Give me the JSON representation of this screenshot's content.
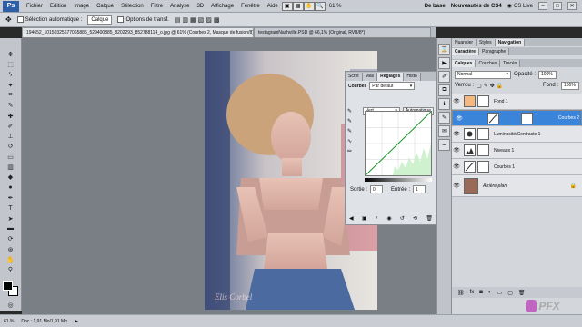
{
  "menubar": {
    "logo": "Ps",
    "items": [
      "Fichier",
      "Edition",
      "Image",
      "Calque",
      "Sélection",
      "Filtre",
      "Analyse",
      "3D",
      "Affichage",
      "Fenêtre",
      "Aide"
    ],
    "zoom": "61 %",
    "workspace": "De base",
    "workspace2": "Nouveautés de CS4",
    "cslive": "CS Live"
  },
  "options": {
    "auto_select_label": "Sélection automatique :",
    "auto_select_value": "Calque",
    "transform_label": "Options de transf."
  },
  "doctabs": [
    {
      "label": "194652_10150325677065886_529400885_8202293_852788114_o.jpg @ 61% (Courbes 2, Masque de fusion/8) *"
    },
    {
      "label": "testagramNashville.PSD @ 66,1% (Original, RVB/8*)"
    }
  ],
  "photo_watermark": "Elis Corbel",
  "adjustments": {
    "tabs": [
      "Scrnt",
      "Mas",
      "Réglages",
      "Histo"
    ],
    "title": "Courbes",
    "preset": "Par défaut",
    "channel": "Vert",
    "auto_label": "Automatique",
    "output_label": "Sortie :",
    "output_value": "0",
    "input_label": "Entrée :",
    "input_value": "1"
  },
  "panels": {
    "top_tabs": [
      "Nuancier",
      "Styles",
      "Navigation"
    ],
    "mid_tabs": [
      "Caractère",
      "Paragraphe"
    ],
    "layer_tabs": [
      "Calques",
      "Couches",
      "Tracés"
    ],
    "blend_mode": "Normal",
    "opacity_label": "Opacité :",
    "opacity_value": "100%",
    "lock_label": "Verrou :",
    "fill_label": "Fond :",
    "fill_value": "100%"
  },
  "layers": [
    {
      "name": "Fond 1",
      "selected": false,
      "thumb": "#f4b880"
    },
    {
      "name": "Courbes 2",
      "selected": true,
      "thumb": "#ffffff"
    },
    {
      "name": "Luminosité/Contraste 1",
      "selected": false,
      "thumb": "#ffffff"
    },
    {
      "name": "Niveaux 1",
      "selected": false,
      "thumb": "#ffffff"
    },
    {
      "name": "Courbes 1",
      "selected": false,
      "thumb": "#ffffff"
    },
    {
      "name": "Arrière-plan",
      "selected": false,
      "thumb": "#9a6a58"
    }
  ],
  "status": {
    "zoom": "61 %",
    "doc": "Doc : 1,91 Mo/1,91 Mo"
  },
  "logo_watermark": "PFX"
}
